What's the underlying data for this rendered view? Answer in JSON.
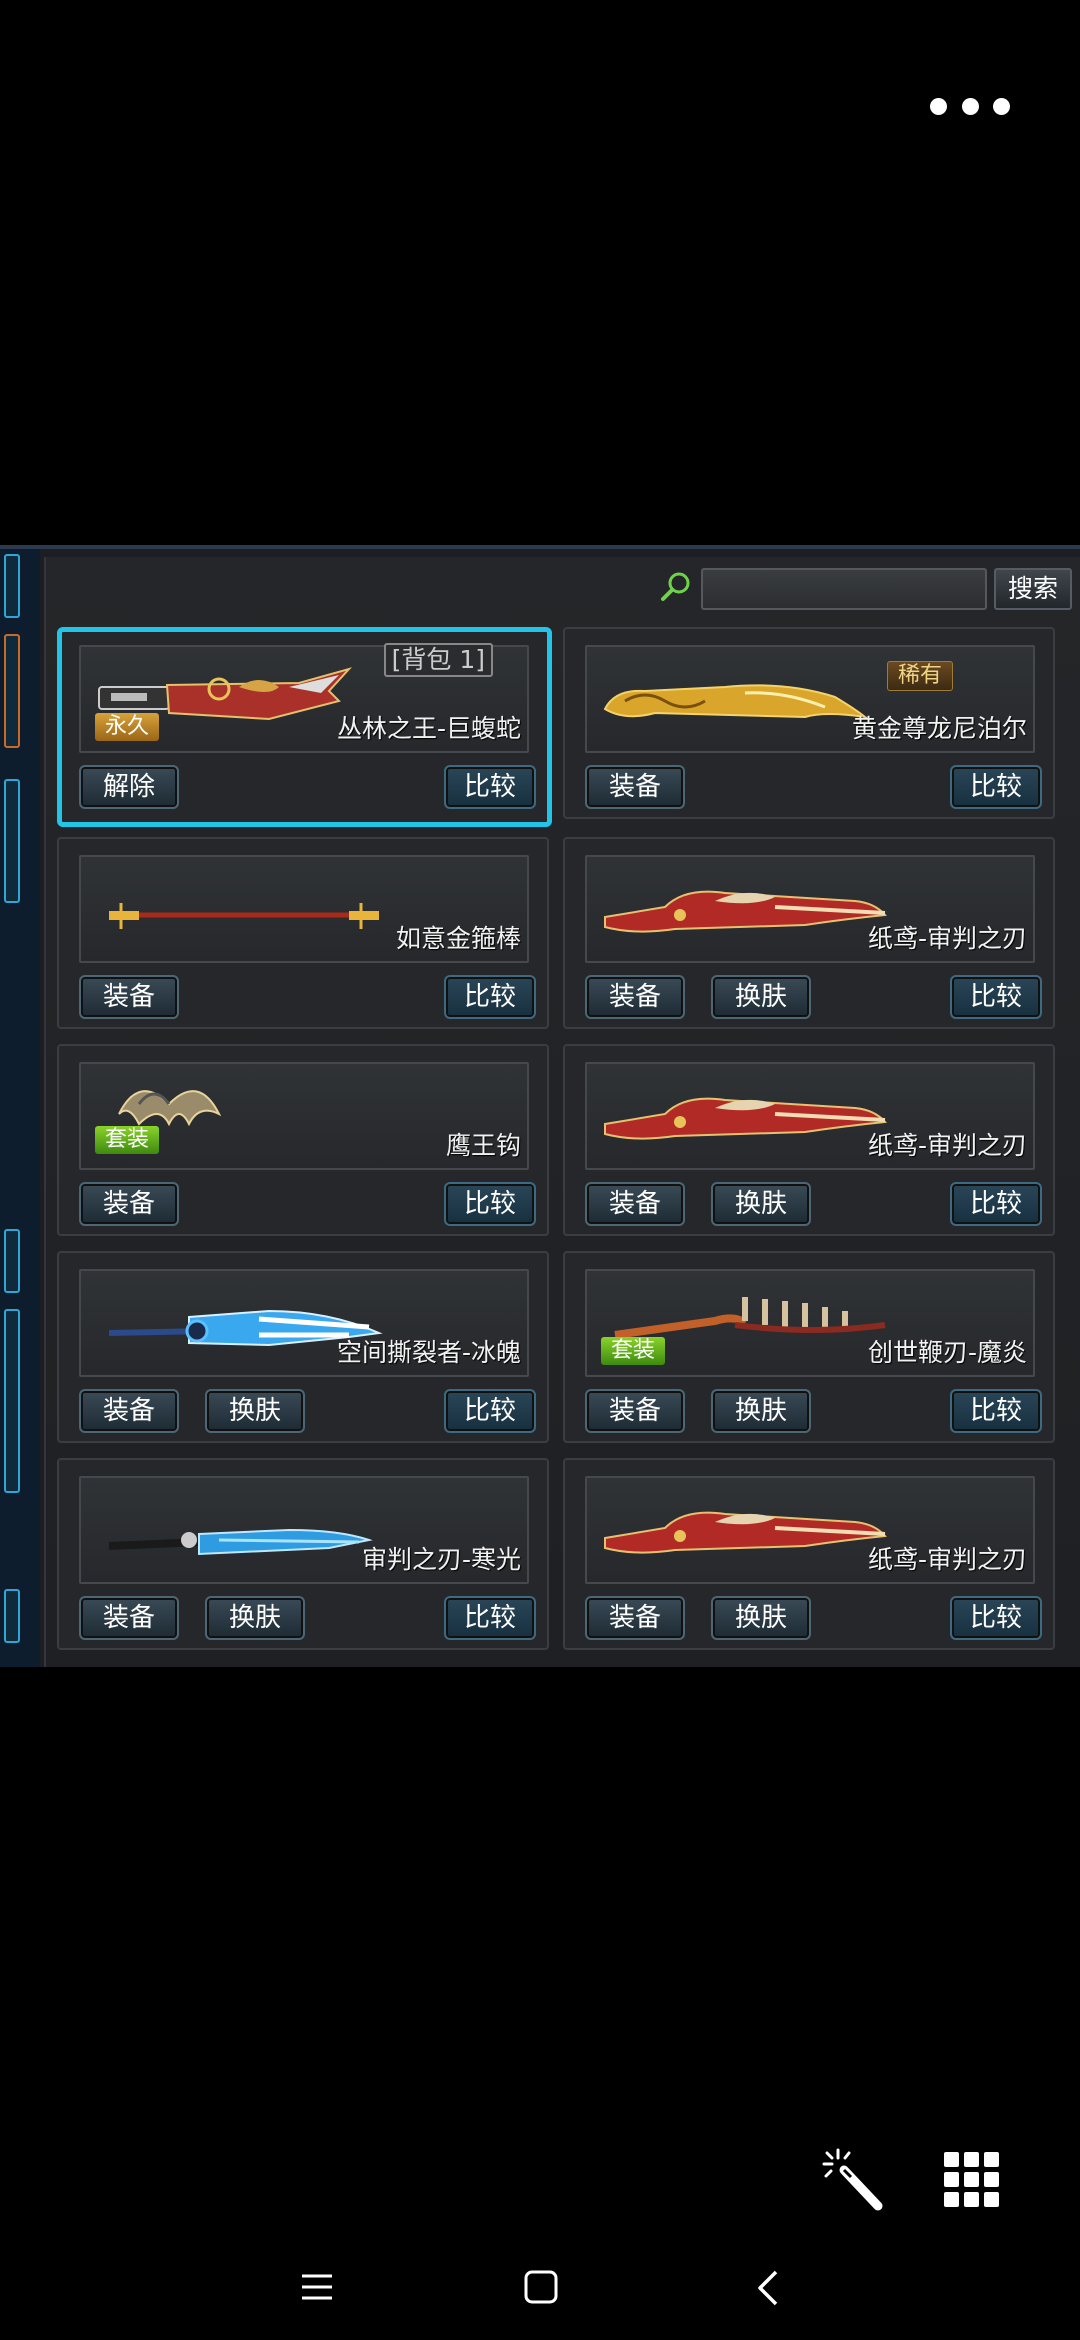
{
  "topbar": {
    "more_icon": "more-dots-icon"
  },
  "search": {
    "placeholder": "",
    "value": "",
    "button_label": "搜索",
    "icon": "magnifier-icon"
  },
  "cards": [
    {
      "name": "丛林之王-巨蝮蛇",
      "slot_tag": "[背包 1]",
      "badge": "永久",
      "badge_type": "perm",
      "selected": true,
      "buttons": [
        "解除"
      ],
      "compare_label": "比较",
      "art": "gold-red-knife"
    },
    {
      "name": "黄金尊龙尼泊尔",
      "badge": "稀有",
      "badge_type": "rare",
      "buttons": [
        "装备"
      ],
      "compare_label": "比较",
      "art": "gold-dragon-blade"
    },
    {
      "name": "如意金箍棒",
      "buttons": [
        "装备"
      ],
      "compare_label": "比较",
      "art": "staff"
    },
    {
      "name": "纸鸢-审判之刃",
      "buttons": [
        "装备",
        "换肤"
      ],
      "compare_label": "比较",
      "art": "red-blade"
    },
    {
      "name": "鹰王钩",
      "badge": "套装",
      "badge_type": "suit",
      "buttons": [
        "装备"
      ],
      "compare_label": "比较",
      "art": "claw"
    },
    {
      "name": "纸鸢-审判之刃",
      "buttons": [
        "装备",
        "换肤"
      ],
      "compare_label": "比较",
      "art": "red-blade"
    },
    {
      "name": "空间撕裂者-冰魄",
      "buttons": [
        "装备",
        "换肤"
      ],
      "compare_label": "比较",
      "art": "blue-cleaver"
    },
    {
      "name": "创世鞭刃-魔炎",
      "badge": "套装",
      "badge_type": "suit",
      "buttons": [
        "装备",
        "换肤"
      ],
      "compare_label": "比较",
      "art": "spine-whip"
    },
    {
      "name": "审判之刃-寒光",
      "buttons": [
        "装备",
        "换肤"
      ],
      "compare_label": "比较",
      "art": "ice-blade"
    },
    {
      "name": "纸鸢-审判之刃",
      "buttons": [
        "装备",
        "换肤"
      ],
      "compare_label": "比较",
      "art": "red-blade"
    }
  ],
  "floating_tools": {
    "magic_icon": "magic-wand-icon",
    "grid_icon": "grid-menu-icon"
  },
  "nav": {
    "menu_icon": "menu-icon",
    "home_icon": "home-square-icon",
    "back_icon": "back-chevron-icon"
  },
  "colors": {
    "selection": "#22c4e8",
    "perm_badge": "#d8a23a",
    "suit_badge": "#7ac323"
  }
}
